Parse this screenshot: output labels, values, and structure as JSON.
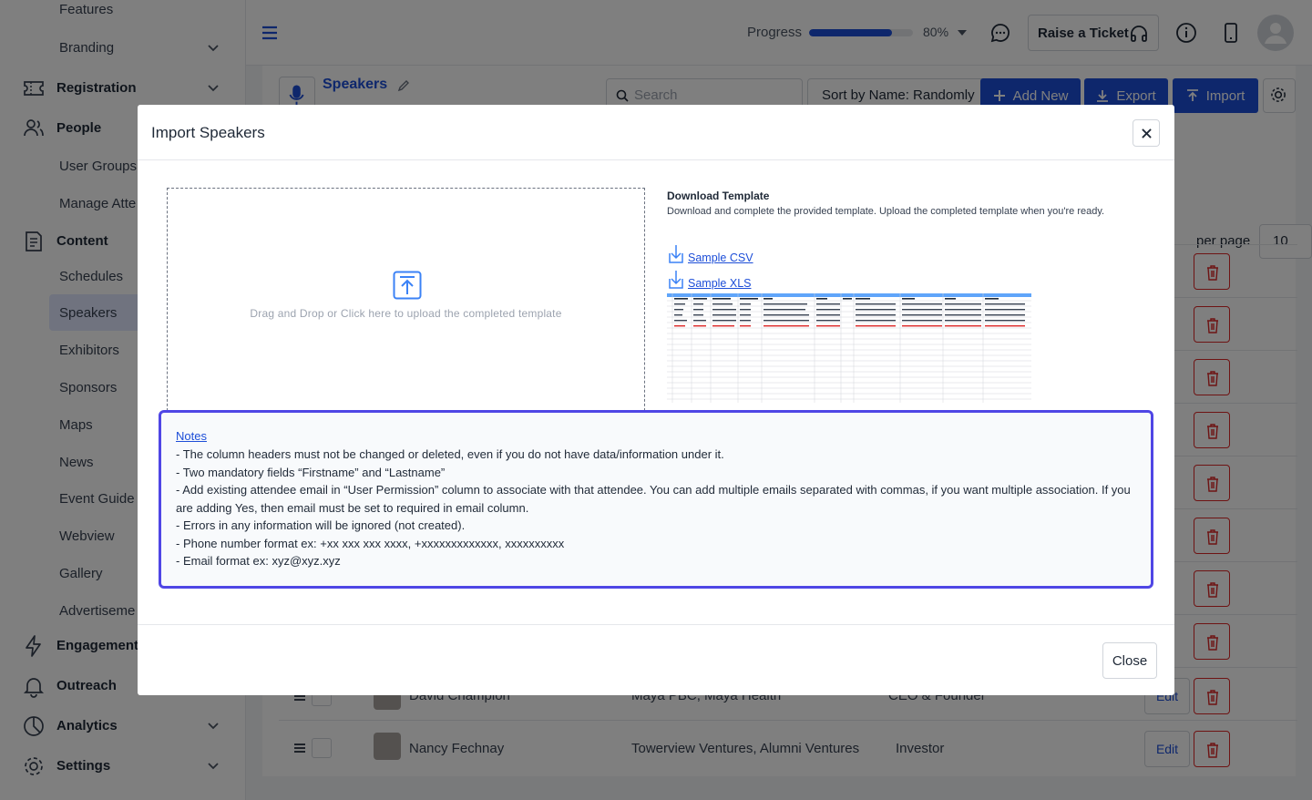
{
  "sidebar": {
    "items": [
      {
        "label": "Features",
        "type": "sub"
      },
      {
        "label": "Branding",
        "type": "sub"
      },
      {
        "label": "Registration",
        "type": "top"
      },
      {
        "label": "People",
        "type": "top"
      },
      {
        "label": "User Groups",
        "type": "sub"
      },
      {
        "label": "Manage Atte",
        "type": "sub"
      },
      {
        "label": "Content",
        "type": "top"
      },
      {
        "label": "Schedules",
        "type": "sub"
      },
      {
        "label": "Speakers",
        "type": "sub",
        "active": true
      },
      {
        "label": "Exhibitors",
        "type": "sub"
      },
      {
        "label": "Sponsors",
        "type": "sub"
      },
      {
        "label": "Maps",
        "type": "sub"
      },
      {
        "label": "News",
        "type": "sub"
      },
      {
        "label": "Event Guide",
        "type": "sub"
      },
      {
        "label": "Webview",
        "type": "sub"
      },
      {
        "label": "Gallery",
        "type": "sub"
      },
      {
        "label": "Advertiseme",
        "type": "sub"
      },
      {
        "label": "Engagement",
        "type": "top"
      },
      {
        "label": "Outreach",
        "type": "top"
      },
      {
        "label": "Analytics",
        "type": "top"
      },
      {
        "label": "Settings",
        "type": "top"
      }
    ]
  },
  "topbar": {
    "progress_label": "Progress",
    "progress_value": 0.8,
    "progress_pct": "80%",
    "ticket_label": "Raise a Ticket"
  },
  "page": {
    "title": "Speakers",
    "subtitle": "Speakers",
    "search_placeholder": "Search",
    "sort_label": "Sort by Name: Randomly",
    "add_new_label": "Add New",
    "export_label": "Export",
    "import_label": "Import",
    "per_page_label": "per page",
    "per_page_value": "10",
    "edit_label": "Edit",
    "rows": [
      {
        "name": "David Champion",
        "company": "Maya PBC, Maya Health",
        "title": "CEO & Founder"
      },
      {
        "name": "Nancy Fechnay",
        "company": "Towerview Ventures, Alumni Ventures",
        "title": "Investor"
      }
    ]
  },
  "modal": {
    "title": "Import Speakers",
    "dropzone_text": "Drag and Drop or Click here to upload the completed template",
    "template_title": "Download Template",
    "template_desc": "Download and complete the provided template. Upload the completed template when you're ready.",
    "sample_csv": "Sample CSV",
    "sample_xls": "Sample XLS",
    "notes_title": "Notes",
    "notes": [
      "- The column headers must not be changed or deleted, even if you do not have data/information under it.",
      "- Two mandatory fields “Firstname” and “Lastname”",
      "- Add existing attendee email in “User Permission” column to associate with that attendee. You can add multiple emails separated with commas, if you want multiple association. If you are adding Yes, then email must be set to required in email column.",
      "- Errors in any information will be ignored (not created).",
      "- Phone number format ex: +xx xxx xxx xxxx, +xxxxxxxxxxxxx, xxxxxxxxxx",
      "- Email format ex: xyz@xyz.xyz"
    ],
    "close_label": "Close"
  },
  "colors": {
    "primary": "#1d4ed8",
    "notes_border": "#4f46e5",
    "danger": "#dc2626"
  }
}
